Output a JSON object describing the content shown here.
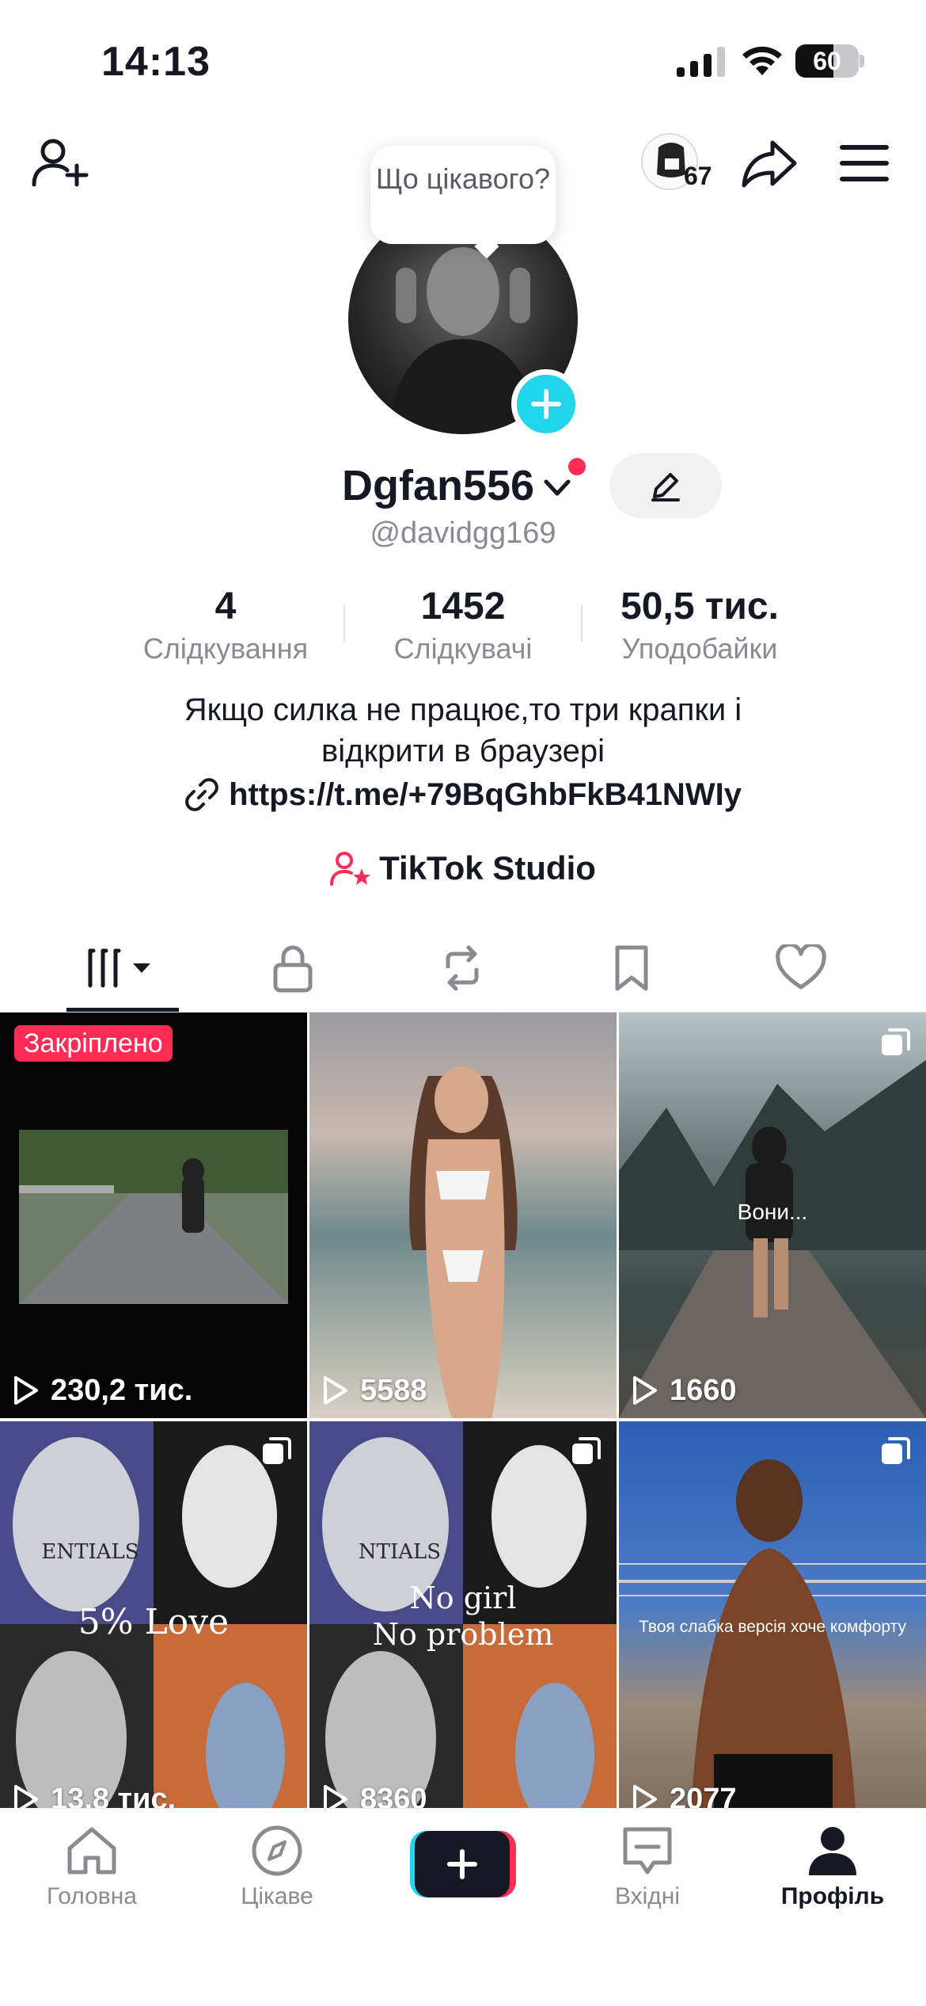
{
  "status_bar": {
    "time": "14:13",
    "battery": "60",
    "battery_level": 0.6
  },
  "header": {
    "visitors_count": "67"
  },
  "profile": {
    "bubble_text": "Що цікавого?",
    "display_name": "Dgfan556",
    "username": "@davidgg169"
  },
  "stats": [
    {
      "value": "4",
      "label": "Слідкування"
    },
    {
      "value": "1452",
      "label": "Слідкувачі"
    },
    {
      "value": "50,5 тис.",
      "label": "Уподобайки"
    }
  ],
  "bio": {
    "line1": "Якщо силка не працює,то три крапки і",
    "line2": "відкрити в браузері",
    "link": "https://t.me/+79BqGhbFkB41NWIy"
  },
  "studio": {
    "label": "TikTok Studio"
  },
  "videos": [
    {
      "pinned_label": "Закріплено",
      "views": "230,2 тис."
    },
    {
      "views": "5588"
    },
    {
      "views": "1660",
      "caption": "Вони..."
    },
    {
      "views": "13,8 тис.",
      "caption": "5% Love",
      "overlay_text": "ENTIALS"
    },
    {
      "views": "8360",
      "caption_line1": "No girl",
      "caption_line2": "No problem",
      "overlay_text": "NTIALS"
    },
    {
      "views": "2077",
      "caption": "Твоя слабка версія хоче комфорту"
    }
  ],
  "bottom_nav": [
    {
      "label": "Головна"
    },
    {
      "label": "Цікаве"
    },
    {
      "label": "Вхідні"
    },
    {
      "label": "Профіль"
    }
  ],
  "colors": {
    "accent": "#fe2c55",
    "cyan": "#20d5ec",
    "text": "#161823",
    "secondary": "#8a8b91"
  }
}
